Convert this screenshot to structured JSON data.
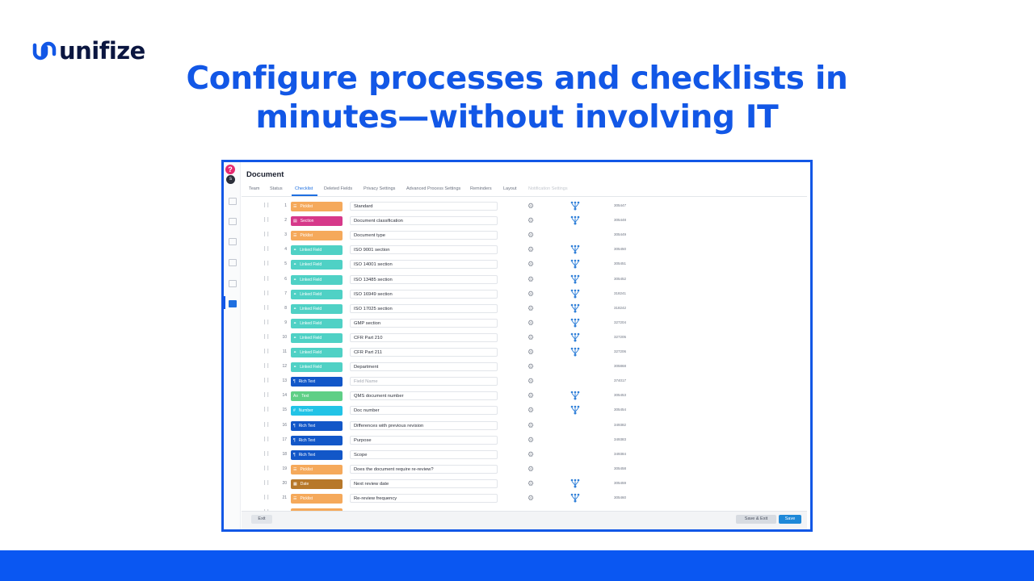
{
  "brand": {
    "name": "unifize",
    "mark_color": "#1257e6",
    "text_color": "#0b1640"
  },
  "headline": {
    "line1": "Configure processes and checklists in",
    "line2": "minutes—without involving IT",
    "color": "#1257e6"
  },
  "app": {
    "help_icon": "?",
    "user_initial": "s",
    "rail_icons": [
      "home-icon",
      "chat-icon",
      "list-icon",
      "doc-icon",
      "grid-icon",
      "manage-icon"
    ],
    "title": "Document",
    "tabs": [
      {
        "label": "Team",
        "active": false,
        "disabled": false
      },
      {
        "label": "Status",
        "active": false,
        "disabled": false
      },
      {
        "label": "Checklist",
        "active": true,
        "disabled": false
      },
      {
        "label": "Deleted Fields",
        "active": false,
        "disabled": false
      },
      {
        "label": "Privacy Settings",
        "active": false,
        "disabled": false
      },
      {
        "label": "Advanced Process Settings",
        "active": false,
        "disabled": false
      },
      {
        "label": "Reminders",
        "active": false,
        "disabled": false
      },
      {
        "label": "Layout",
        "active": false,
        "disabled": false
      },
      {
        "label": "Notification Settings",
        "active": false,
        "disabled": true
      }
    ],
    "field_types": {
      "picklist": {
        "label": "Picklist",
        "icon": "list-icon",
        "color": "#f5a95b"
      },
      "section": {
        "label": "Section",
        "icon": "section-icon",
        "color": "#d6398a"
      },
      "linked": {
        "label": "Linked Field",
        "icon": "link-icon",
        "color": "#4fd1c5"
      },
      "richtext": {
        "label": "Rich Text",
        "icon": "richtext-icon",
        "color": "#1257c8"
      },
      "text": {
        "label": "Text",
        "icon": "text-icon",
        "color": "#5fcf86"
      },
      "number": {
        "label": "Number",
        "icon": "hash-icon",
        "color": "#22c3e6"
      },
      "date": {
        "label": "Date",
        "icon": "calendar-icon",
        "color": "#b7782a"
      }
    },
    "rows": [
      {
        "num": "1",
        "type": "picklist",
        "name": "Standard",
        "placeholder": false,
        "tree": true,
        "id": "305447"
      },
      {
        "num": "2",
        "type": "section",
        "name": "Document classification",
        "placeholder": false,
        "tree": true,
        "id": "305448"
      },
      {
        "num": "3",
        "type": "picklist",
        "name": "Document type",
        "placeholder": false,
        "tree": false,
        "id": "305449"
      },
      {
        "num": "4",
        "type": "linked",
        "name": "ISO 9001 section",
        "placeholder": false,
        "tree": true,
        "id": "305450"
      },
      {
        "num": "5",
        "type": "linked",
        "name": "ISO 14001 section",
        "placeholder": false,
        "tree": true,
        "id": "305451"
      },
      {
        "num": "6",
        "type": "linked",
        "name": "ISO 13485 section",
        "placeholder": false,
        "tree": true,
        "id": "305452"
      },
      {
        "num": "7",
        "type": "linked",
        "name": "ISO 16949 section",
        "placeholder": false,
        "tree": true,
        "id": "318241"
      },
      {
        "num": "8",
        "type": "linked",
        "name": "ISO 17025 section",
        "placeholder": false,
        "tree": true,
        "id": "318242"
      },
      {
        "num": "9",
        "type": "linked",
        "name": "GMP section",
        "placeholder": false,
        "tree": true,
        "id": "327204"
      },
      {
        "num": "10",
        "type": "linked",
        "name": "CFR Part 210",
        "placeholder": false,
        "tree": true,
        "id": "327205"
      },
      {
        "num": "11",
        "type": "linked",
        "name": "CFR Part 211",
        "placeholder": false,
        "tree": true,
        "id": "327206"
      },
      {
        "num": "12",
        "type": "linked",
        "name": "Department",
        "placeholder": false,
        "tree": false,
        "id": "305868"
      },
      {
        "num": "13",
        "type": "richtext",
        "name": "Field Name",
        "placeholder": true,
        "tree": false,
        "id": "374017"
      },
      {
        "num": "14",
        "type": "text",
        "name": "QMS document number",
        "placeholder": false,
        "tree": true,
        "id": "305453"
      },
      {
        "num": "15",
        "type": "number",
        "name": "Doc number",
        "placeholder": false,
        "tree": true,
        "id": "305454"
      },
      {
        "num": "16",
        "type": "richtext",
        "name": "Differences with previous revision",
        "placeholder": false,
        "tree": false,
        "id": "349382"
      },
      {
        "num": "17",
        "type": "richtext",
        "name": "Purpose",
        "placeholder": false,
        "tree": false,
        "id": "349383"
      },
      {
        "num": "18",
        "type": "richtext",
        "name": "Scope",
        "placeholder": false,
        "tree": false,
        "id": "349384"
      },
      {
        "num": "19",
        "type": "picklist",
        "name": "Does the document require re-review?",
        "placeholder": false,
        "tree": false,
        "id": "305458"
      },
      {
        "num": "20",
        "type": "date",
        "name": "Next review date",
        "placeholder": false,
        "tree": true,
        "id": "305459"
      },
      {
        "num": "21",
        "type": "picklist",
        "name": "Re-review frequency",
        "placeholder": false,
        "tree": true,
        "id": "305460"
      },
      {
        "num": "",
        "type": "picklist",
        "name": "",
        "placeholder": false,
        "tree": false,
        "id": ""
      }
    ],
    "footer": {
      "exit": "Exit",
      "save_exit": "Save & Exit",
      "save": "Save"
    }
  },
  "colors": {
    "accent": "#1257e6",
    "bottom_bar": "#0a57f2",
    "save_button": "#1e88d8"
  }
}
